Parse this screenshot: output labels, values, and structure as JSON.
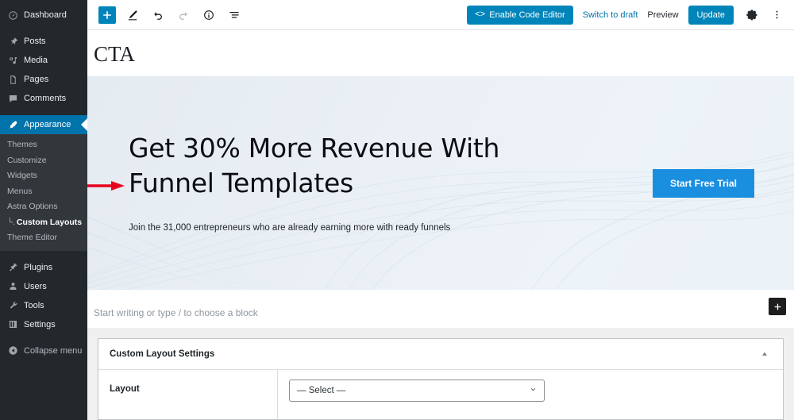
{
  "sidebar": {
    "items": [
      {
        "label": "Dashboard",
        "icon": "dashboard-icon"
      },
      {
        "label": "Posts",
        "icon": "pin-icon"
      },
      {
        "label": "Media",
        "icon": "media-icon"
      },
      {
        "label": "Pages",
        "icon": "pages-icon"
      },
      {
        "label": "Comments",
        "icon": "comments-icon"
      },
      {
        "label": "Appearance",
        "icon": "appearance-brush-icon",
        "active": true
      }
    ],
    "submenu": [
      {
        "label": "Themes"
      },
      {
        "label": "Customize"
      },
      {
        "label": "Widgets"
      },
      {
        "label": "Menus"
      },
      {
        "label": "Astra Options"
      },
      {
        "label": "Custom Layouts",
        "current": true,
        "branch": "└."
      },
      {
        "label": "Theme Editor"
      }
    ],
    "items_bottom": [
      {
        "label": "Plugins",
        "icon": "plugins-icon"
      },
      {
        "label": "Users",
        "icon": "users-icon"
      },
      {
        "label": "Tools",
        "icon": "tools-wrench-icon"
      },
      {
        "label": "Settings",
        "icon": "settings-sliders-icon"
      }
    ],
    "collapse_label": "Collapse menu"
  },
  "header": {
    "add_block_title": "Add block",
    "tools": [
      {
        "name": "add-block-button",
        "icon": "plus-icon"
      },
      {
        "name": "edit-tool-button",
        "icon": "pencil-icon"
      },
      {
        "name": "undo-button",
        "icon": "undo-icon"
      },
      {
        "name": "redo-button",
        "icon": "redo-icon",
        "disabled": true
      },
      {
        "name": "details-button",
        "icon": "info-icon"
      },
      {
        "name": "list-view-button",
        "icon": "list-view-icon"
      }
    ],
    "code_editor_label": "Enable Code Editor",
    "code_editor_glyph": "<>",
    "switch_to_draft_label": "Switch to draft",
    "preview_label": "Preview",
    "update_label": "Update",
    "settings_icon": "gear-icon",
    "more_icon": "more-vertical-icon"
  },
  "editor": {
    "post_title": "CTA",
    "hero": {
      "heading": "Get 30% More Revenue With Funnel Templates",
      "subheading": "Join the 31,000 entrepreneurs who are already earning more with ready funnels",
      "cta_label": "Start Free Trial",
      "cta_color": "#1a8fe0",
      "bg_from": "#e4ebf1",
      "bg_to": "#edf3f9"
    },
    "appender_placeholder": "Start writing or type / to choose a block",
    "add_block_icon": "plus-icon"
  },
  "metabox": {
    "title": "Custom Layout Settings",
    "toggle_icon": "chevron-up-icon",
    "rows": [
      {
        "label": "Layout",
        "field_type": "select",
        "value": "— Select —",
        "options": [
          "— Select —"
        ]
      }
    ]
  },
  "annotation": {
    "arrow_color": "#e8001c",
    "arrow_direction": "right"
  }
}
